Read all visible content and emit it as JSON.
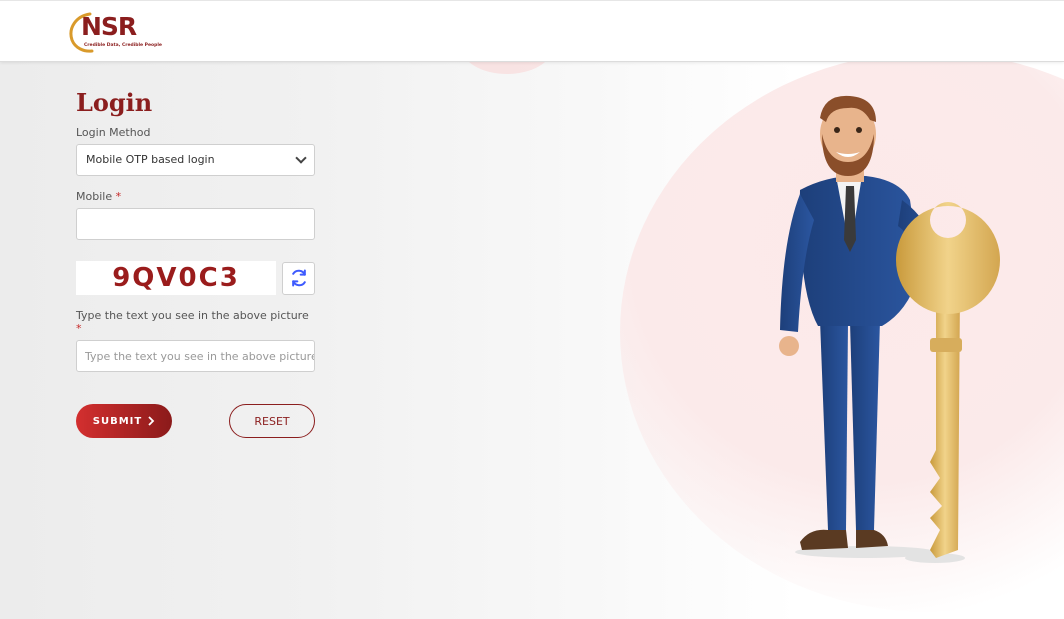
{
  "brand": {
    "logo_text": "NSR",
    "tagline": "Credible Data, Credible People",
    "color": "#8b1e1e"
  },
  "login": {
    "title": "Login",
    "method_label": "Login Method",
    "method_selected": "Mobile OTP based login",
    "mobile_label": "Mobile",
    "required_mark": "*",
    "mobile_value": "",
    "captcha_text": "9QV0C3",
    "captcha_label": "Type the text you see in the above picture",
    "captcha_placeholder": "Type the text you see in the above picture",
    "submit_label": "SUBMIT",
    "reset_label": "RESET"
  },
  "icons": {
    "refresh": "refresh-icon",
    "dropdown": "chevron-down-icon",
    "submit_arrow": "chevron-right-icon"
  },
  "colors": {
    "accent": "#8b1e1e",
    "button_gradient_start": "#d32f2f",
    "button_gradient_end": "#8b1a1a",
    "refresh_icon": "#3d5afe"
  }
}
